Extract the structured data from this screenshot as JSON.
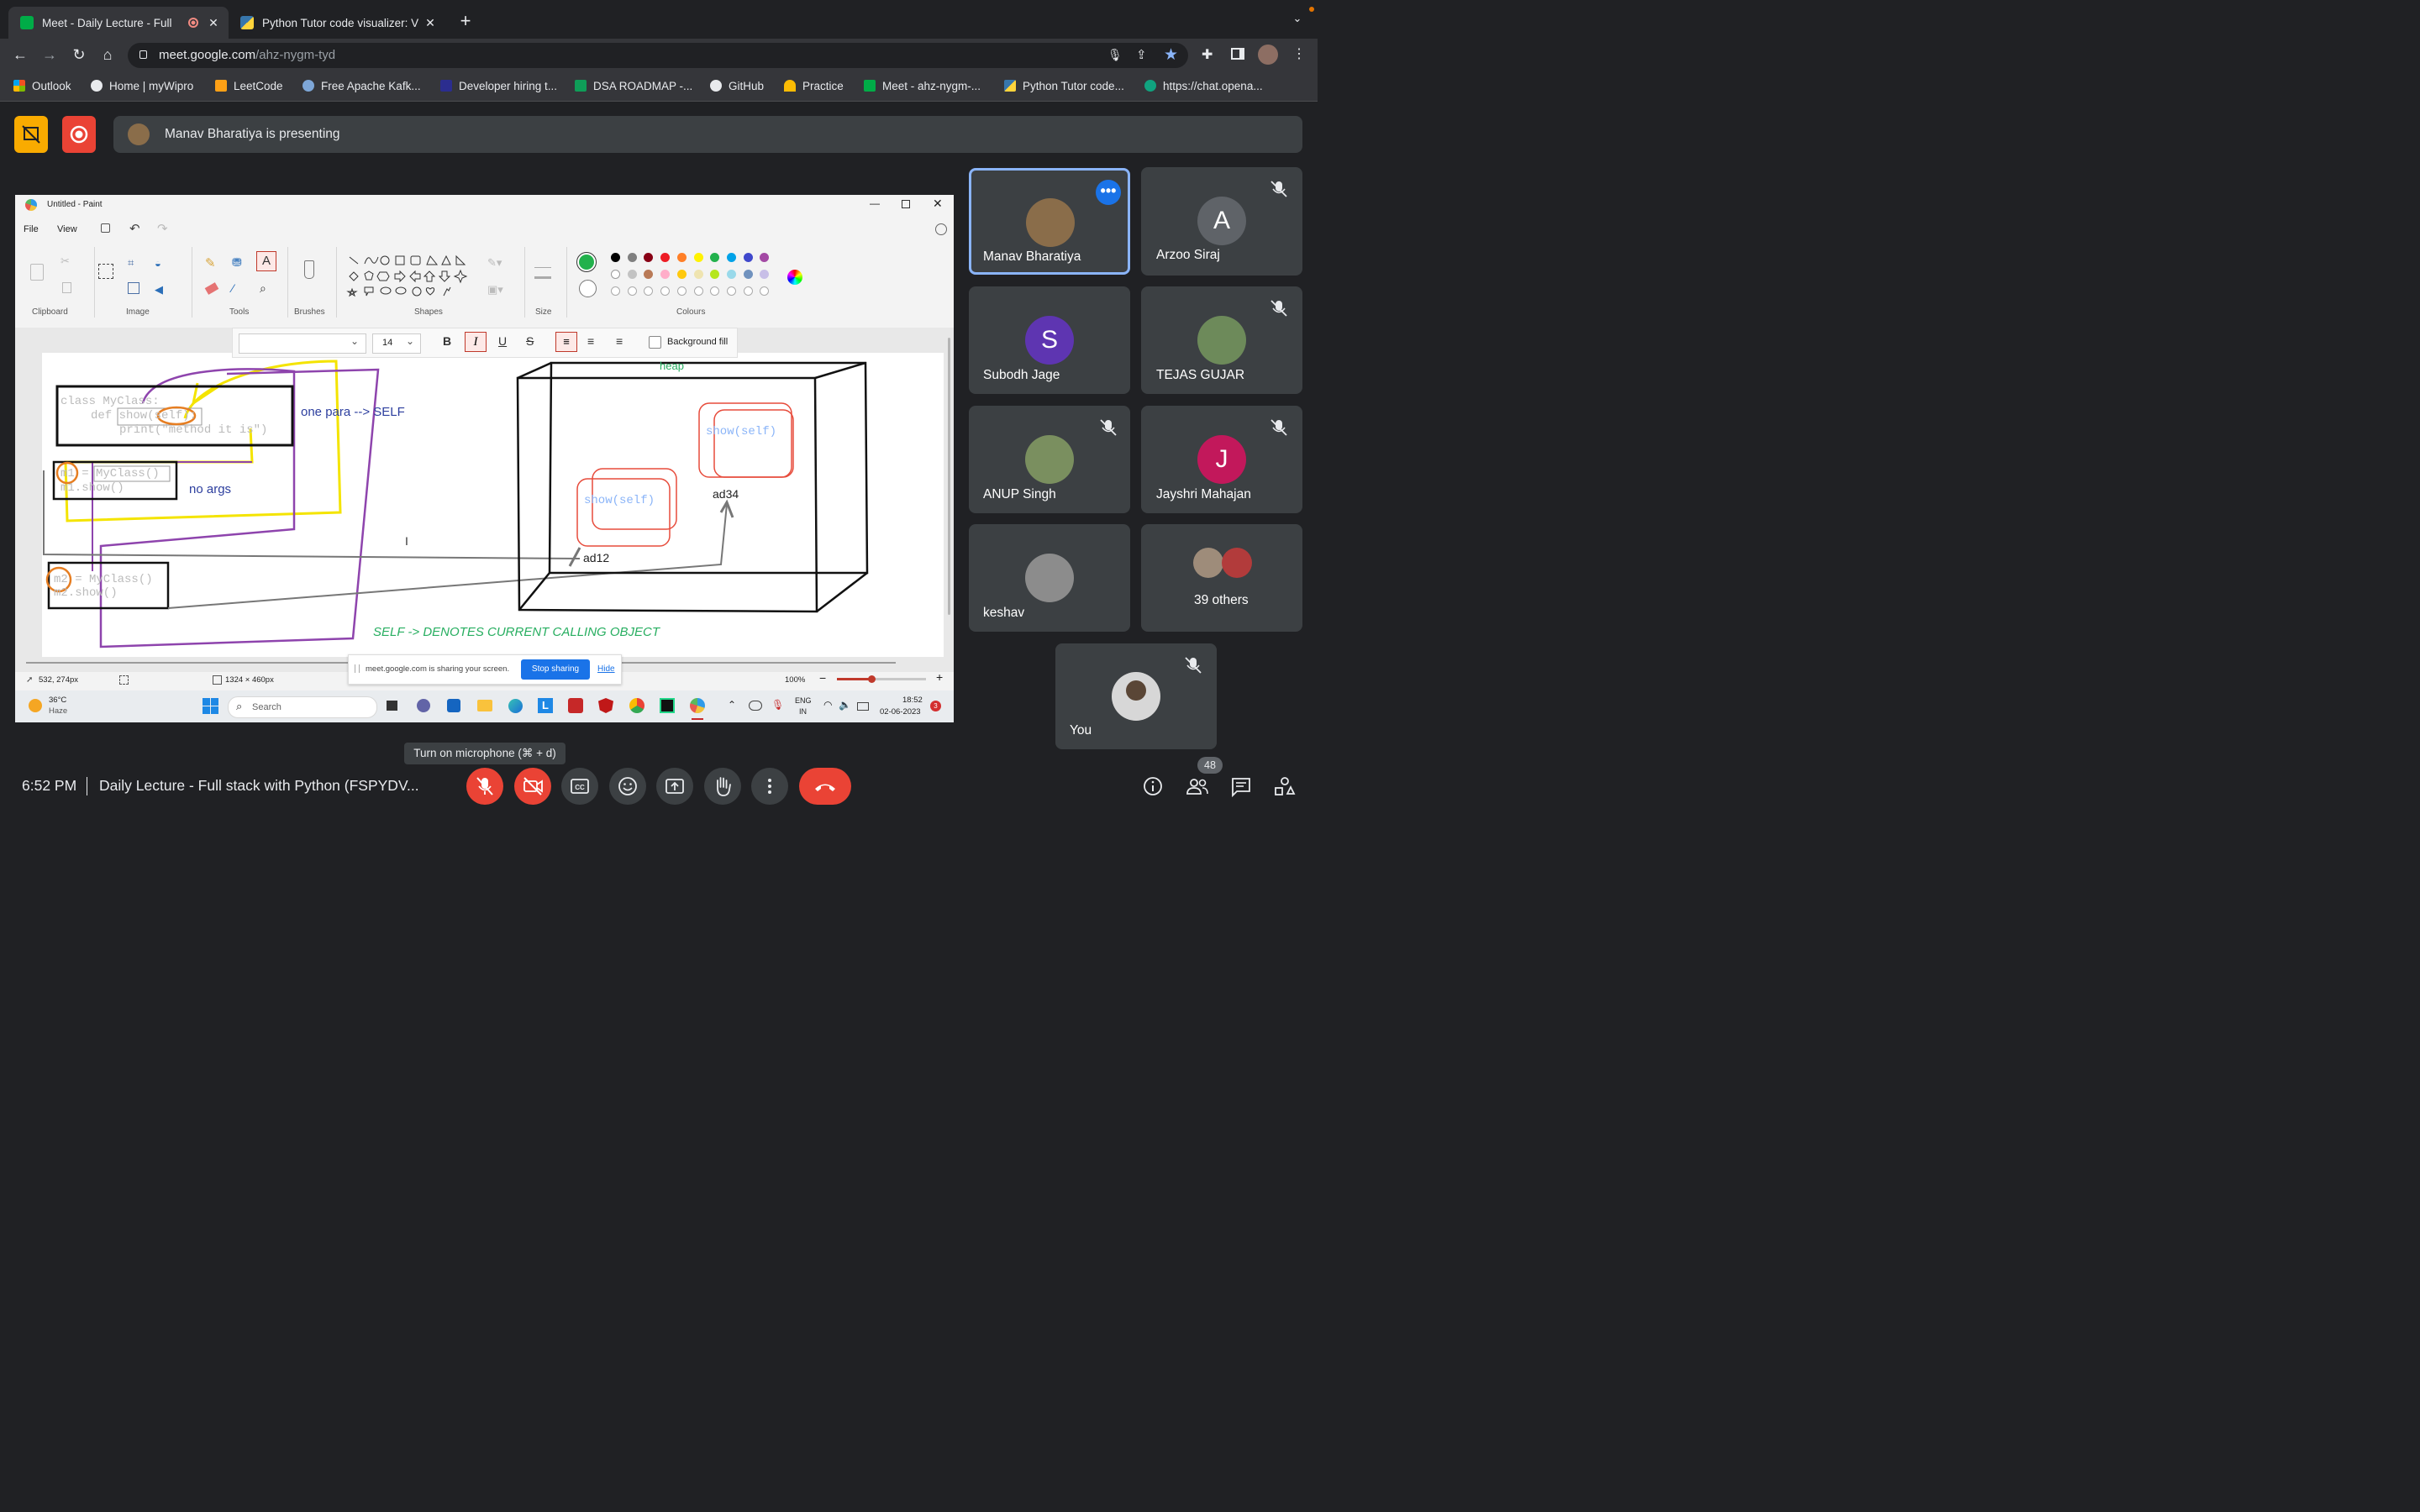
{
  "browser": {
    "tabs": [
      {
        "title": "Meet - Daily Lecture - Full",
        "active": true,
        "recording": true
      },
      {
        "title": "Python Tutor code visualizer: V",
        "active": false
      }
    ],
    "url_host": "meet.google.com",
    "url_path": "/ahz-nygm-tyd",
    "bookmarks": [
      {
        "label": "Outlook",
        "color": "#f25022"
      },
      {
        "label": "Home | myWipro",
        "color": "#ffffff"
      },
      {
        "label": "LeetCode",
        "color": "#ffa116"
      },
      {
        "label": "Free Apache Kafk...",
        "color": "#7ea7d8"
      },
      {
        "label": "Developer hiring t...",
        "color": "#2b2d8f"
      },
      {
        "label": "DSA ROADMAP -...",
        "color": "#0f9d58"
      },
      {
        "label": "GitHub",
        "color": "#ffffff"
      },
      {
        "label": "Practice",
        "color": "#fbbc04"
      },
      {
        "label": "Meet - ahz-nygm-...",
        "color": "#00ac47"
      },
      {
        "label": "Python Tutor code...",
        "color": "#3776ab"
      },
      {
        "label": "https://chat.opena...",
        "color": "#10a37f"
      }
    ]
  },
  "meet": {
    "presenting_text": "Manav Bharatiya is presenting",
    "time": "6:52 PM",
    "meeting_title": "Daily Lecture - Full stack with Python (FSPYDV...",
    "mic_tooltip": "Turn on microphone (⌘ + d)",
    "people_count": "48",
    "participants": [
      {
        "name": "Manav Bharatiya",
        "initial": "",
        "bg": "#8a6d4a",
        "active": true
      },
      {
        "name": "Arzoo Siraj",
        "initial": "A",
        "bg": "#5f6368"
      },
      {
        "name": "Subodh Jage",
        "initial": "S",
        "bg": "#5e35b1"
      },
      {
        "name": "TEJAS GUJAR",
        "initial": "",
        "bg": "#6d8a5a"
      },
      {
        "name": "ANUP Singh",
        "initial": "",
        "bg": "#7a8f5f"
      },
      {
        "name": "Jayshri Mahajan",
        "initial": "J",
        "bg": "#c2185b"
      },
      {
        "name": "keshav",
        "initial": "",
        "bg": "#8c8c8c"
      },
      {
        "name": "39 others",
        "initial": "",
        "bg": "#3c4043"
      },
      {
        "name": "You",
        "initial": "",
        "bg": "#d7d7d7"
      }
    ]
  },
  "paint": {
    "window_title": "Untitled - Paint",
    "menu": [
      "File",
      "View"
    ],
    "groups": [
      "Clipboard",
      "Image",
      "Tools",
      "Brushes",
      "Shapes",
      "Size",
      "Colours"
    ],
    "font_size": "14",
    "background_fill": "Background fill",
    "palette": [
      "#000000",
      "#7f7f7f",
      "#880015",
      "#ed1c24",
      "#ff7f27",
      "#fff200",
      "#22b14c",
      "#00a2e8",
      "#3f48cc",
      "#a349a4",
      "#ffffff",
      "#c3c3c3",
      "#b97a57",
      "#ffaec9",
      "#ffc90e",
      "#efe4b0",
      "#b5e61d",
      "#99d9ea",
      "#7092be",
      "#c8bfe7"
    ],
    "primary_color": "#22b14c",
    "status_pos": "532, 274px",
    "status_size": "1324 × 460px",
    "zoom": "100%",
    "drawing": {
      "code1": "class MyClass:",
      "code2": "def show(self):",
      "code3": "print(\"method it  is\")",
      "note1": "one para --> SELF",
      "code4": "m1 = MyClass()",
      "code5": "m1.show()",
      "note2": "no args",
      "code6": "m2 = MyClass()",
      "code7": "m2.show()",
      "heap": "heap",
      "obj1": "show(self)",
      "obj2": "show(self)",
      "addr1": "ad12",
      "addr2": "ad34",
      "caption": "SELF -> DENOTES CURRENT CALLING OBJECT"
    },
    "share_bar_text": "meet.google.com is sharing your screen.",
    "stop_sharing": "Stop sharing",
    "hide": "Hide"
  },
  "taskbar": {
    "temp": "36°C",
    "weather": "Haze",
    "search": "Search",
    "lang1": "ENG",
    "lang2": "IN",
    "clock_time": "18:52",
    "clock_date": "02-06-2023",
    "badge": "3"
  }
}
